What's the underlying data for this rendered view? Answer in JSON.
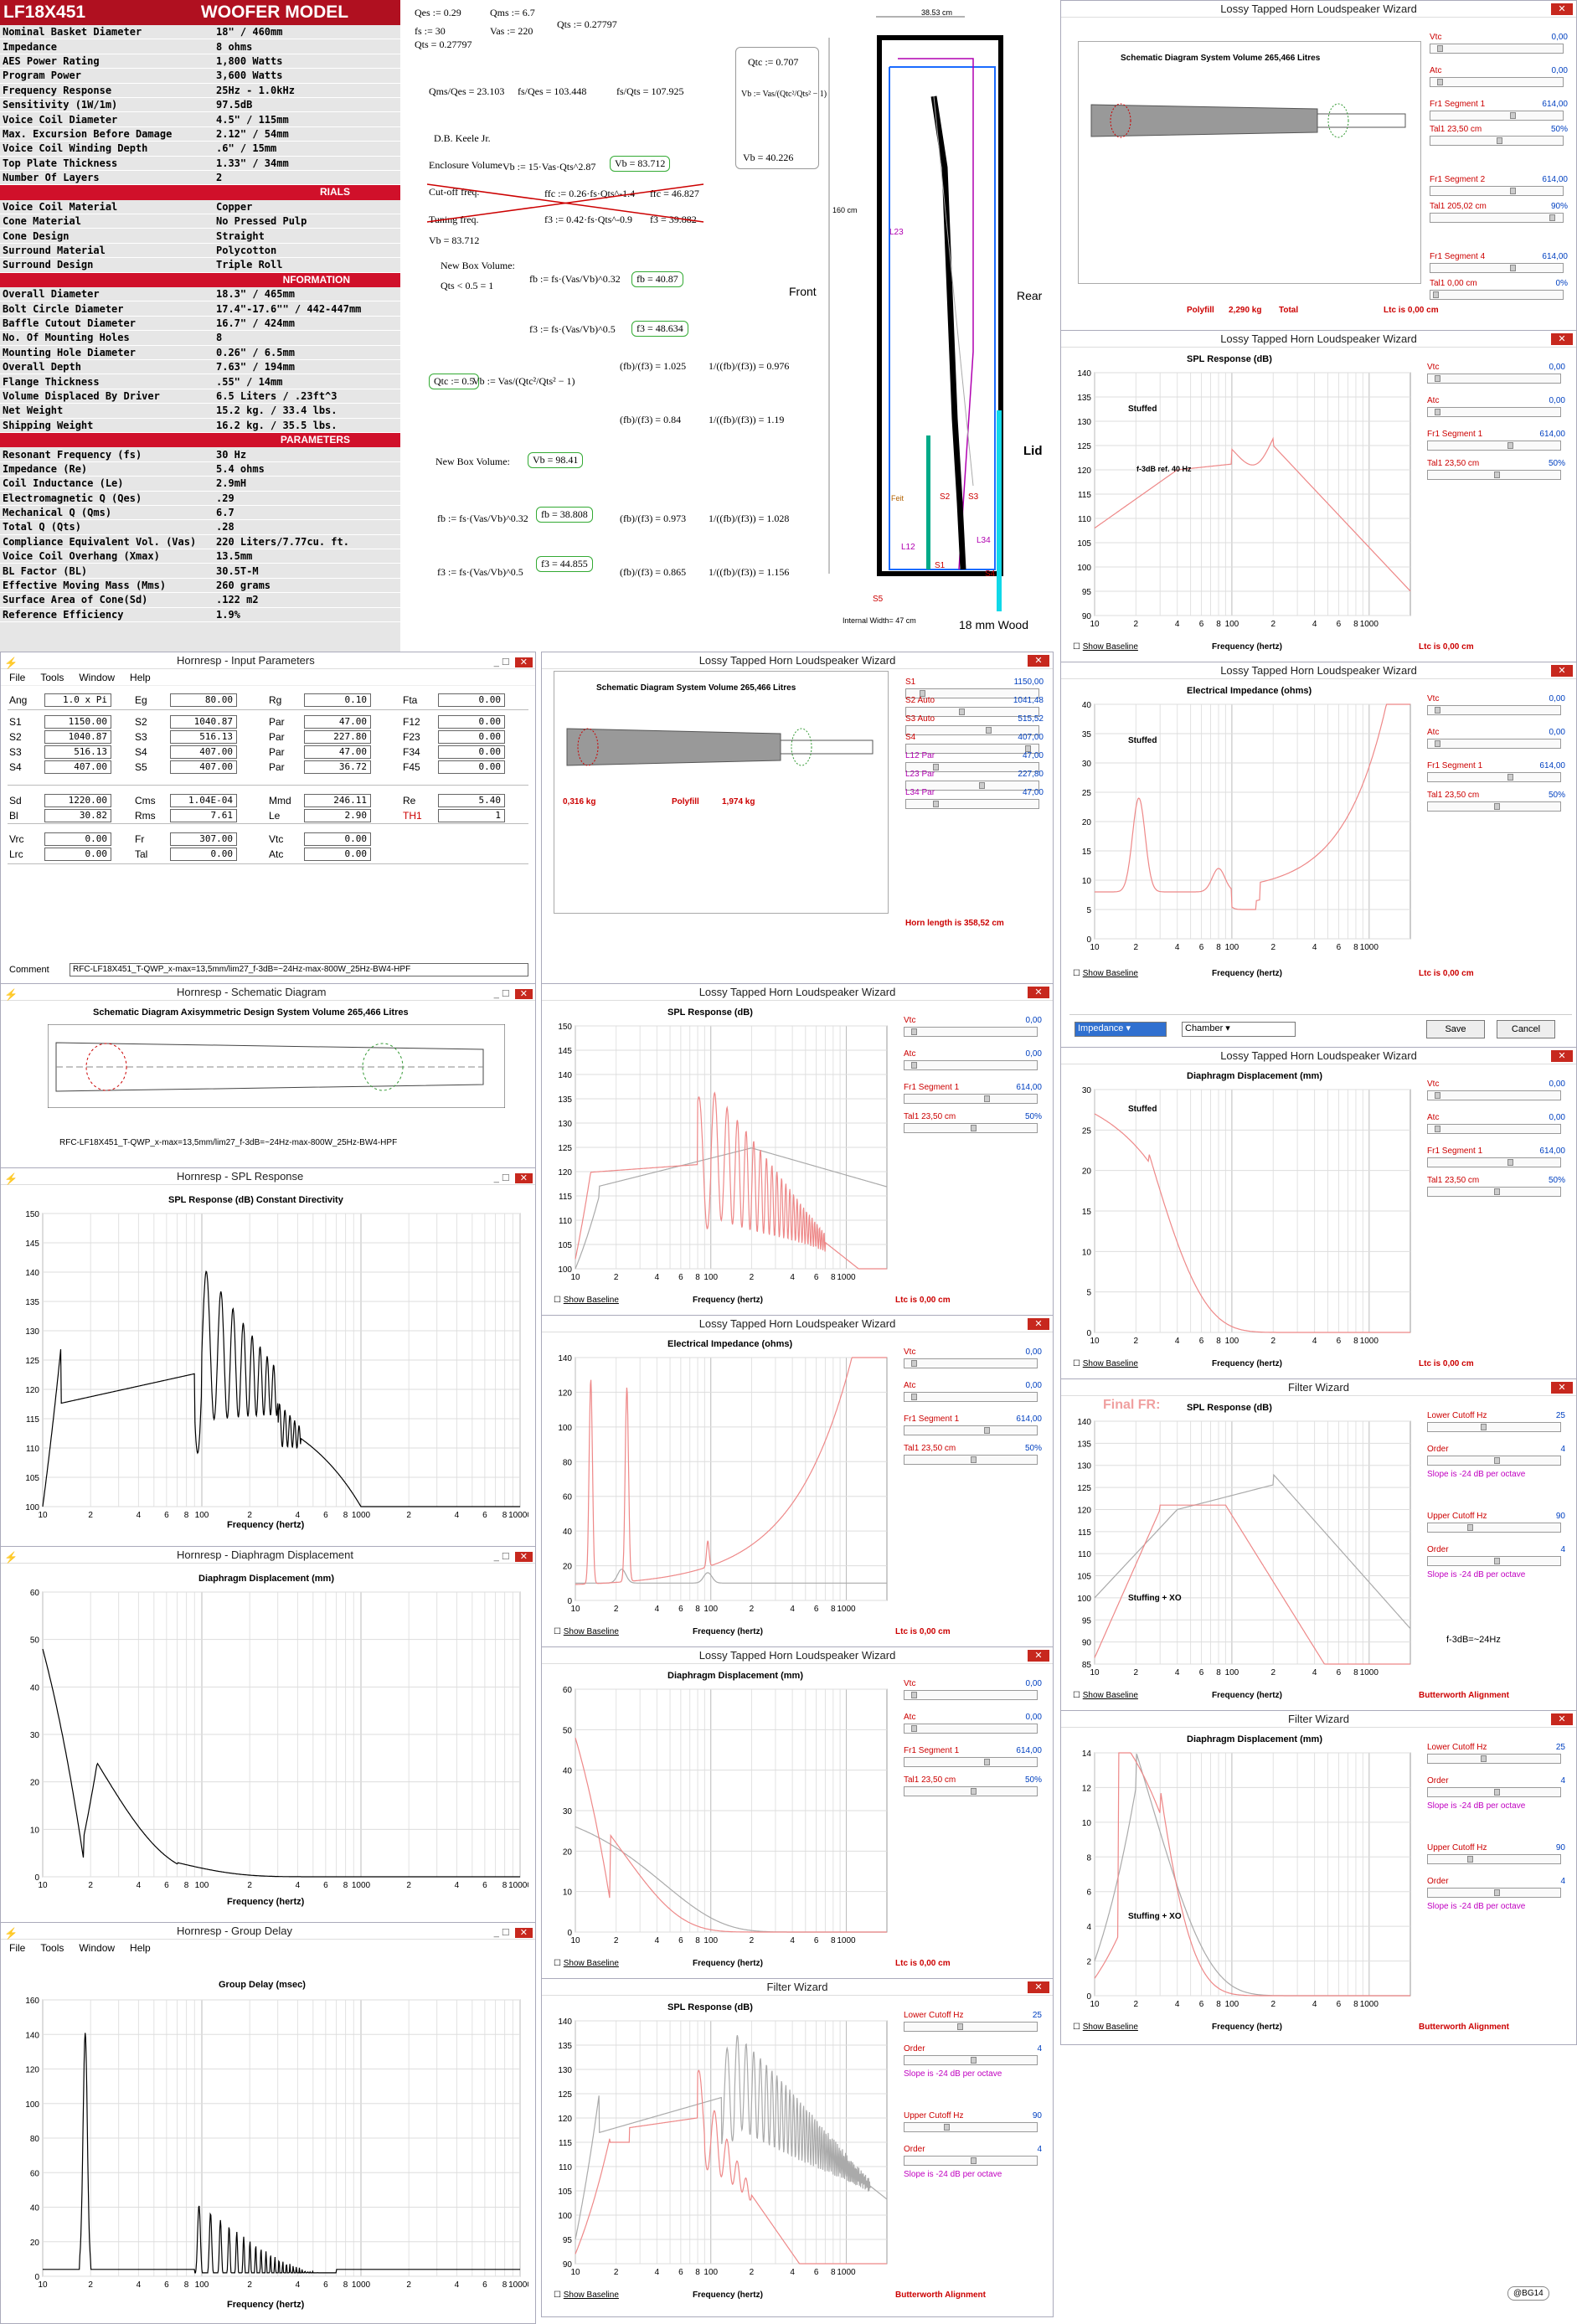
{
  "specs": {
    "model": "LF18X451",
    "title": "WOOFER MODEL",
    "rows": [
      [
        "Nominal Basket Diameter",
        "18\" / 460mm"
      ],
      [
        "Impedance",
        "8 ohms"
      ],
      [
        "AES Power Rating",
        "1,800 Watts"
      ],
      [
        "Program Power",
        "3,600 Watts"
      ],
      [
        "Frequency Response",
        "25Hz - 1.0kHz"
      ],
      [
        "Sensitivity (1W/1m)",
        "97.5dB"
      ],
      [
        "Voice Coil Diameter",
        "4.5\" / 115mm"
      ],
      [
        "Max. Excursion Before Damage",
        "2.12\" / 54mm"
      ],
      [
        "Voice Coil Winding Depth",
        ".6\" / 15mm"
      ],
      [
        "Top Plate Thickness",
        "1.33\" / 34mm"
      ],
      [
        "Number Of Layers",
        "2"
      ]
    ],
    "sec1": "RIALS",
    "rows2": [
      [
        "Voice Coil Material",
        "Copper"
      ],
      [
        "Cone Material",
        "No Pressed Pulp"
      ],
      [
        "Cone Design",
        "Straight"
      ],
      [
        "Surround Material",
        "Polycotton"
      ],
      [
        "Surround Design",
        "Triple Roll"
      ]
    ],
    "sec2": "NFORMATION",
    "rows3": [
      [
        "Overall Diameter",
        "18.3\" / 465mm"
      ],
      [
        "Bolt Circle Diameter",
        "17.4\"-17.6\"\" / 442-447mm"
      ],
      [
        "Baffle Cutout Diameter",
        "16.7\" / 424mm"
      ],
      [
        "No. Of Mounting Holes",
        "8"
      ],
      [
        "Mounting Hole Diameter",
        "0.26\" / 6.5mm"
      ],
      [
        "Overall Depth",
        "7.63\" / 194mm"
      ],
      [
        "Flange Thickness",
        ".55\" / 14mm"
      ],
      [
        "Volume Displaced By Driver",
        "6.5 Liters / .23ft^3"
      ],
      [
        "Net Weight",
        "15.2 kg. / 33.4 lbs."
      ],
      [
        "Shipping Weight",
        "16.2 kg. / 35.5 lbs."
      ]
    ],
    "sec3": "PARAMETERS",
    "rows4": [
      [
        "Resonant Frequency (fs)",
        "30 Hz"
      ],
      [
        "Impedance (Re)",
        "5.4 ohms"
      ],
      [
        "Coil Inductance (Le)",
        "2.9mH"
      ],
      [
        "Electromagnetic Q (Qes)",
        ".29"
      ],
      [
        "Mechanical Q (Qms)",
        "6.7"
      ],
      [
        "Total Q (Qts)",
        ".28"
      ],
      [
        "Compliance Equivalent Vol. (Vas)",
        "220 Liters/7.77cu. ft."
      ],
      [
        "Voice Coil Overhang (Xmax)",
        "13.5mm"
      ],
      [
        "BL Factor (BL)",
        "30.5T-M"
      ],
      [
        "Effective Moving Mass (Mms)",
        "260 grams"
      ],
      [
        "Surface Area of Cone(Sd)",
        ".122 m2"
      ],
      [
        "Reference Efficiency",
        "1.9%"
      ]
    ]
  },
  "calc": {
    "l1": "Qes := 0.29",
    "l2": "Qms := 6.7",
    "l3": "fs := 30",
    "l4": "Vas := 220",
    "l5": "Qts := 0.27797",
    "l6": "Qts = 0.27797",
    "r1": "Qms/Qes = 23.103",
    "r2": "fs/Qes = 103.448",
    "r3": "fs/Qts = 107.925",
    "keele": "D.B. Keele Jr.",
    "encl": "Enclosure Volume",
    "vbf": "Vb := 15·Vas·Qts^2.87",
    "vb1": "Vb = 83.712",
    "cut": "Cut-off freq.",
    "ffc": "ffc := 0.26·fs·Qts^-1.4",
    "ffcv": "ffc = 46.827",
    "tun": "Tuning freq.",
    "f3": "f3 := 0.42·fs·Qts^-0.9",
    "f3v": "f3 = 39.882",
    "vbe": "Vb = 83.712",
    "nbv": "New Box Volume:",
    "qtsc": "Qts < 0.5 = 1",
    "fbf": "fb := fs·(Vas/Vb)^0.32",
    "fbv": "fb = 40.87",
    "f3f": "f3 := fs·(Vas/Vb)^0.5",
    "f3v2": "f3 = 48.634",
    "qtc": "Qtc := 0.5",
    "vbq": "Vb := Vas/(Qtc²/Qts² − 1)",
    "ra": "(fb)/(f3) = 1.025",
    "rb": "1/((fb)/(f3)) = 0.976",
    "rc": "(fb)/(f3) = 0.84",
    "rd": "1/((fb)/(f3)) = 1.19",
    "nbv2": "New Box Volume:",
    "vb2": "Vb = 98.41",
    "fbf2": "fb := fs·(Vas/Vb)^0.32",
    "fbv2": "fb = 38.808",
    "re": "(fb)/(f3) = 0.973",
    "rf": "1/((fb)/(f3)) = 1.028",
    "f3f2": "f3 := fs·(Vas/Vb)^0.5",
    "f3v3": "f3 = 44.855",
    "rg": "(fb)/(f3) = 0.865",
    "rh": "1/((fb)/(f3)) = 1.156",
    "qtcb": "Qtc := 0.707",
    "vbb": "Vb := Vas/(Qtc²/Qts² − 1)",
    "vbbv": "Vb = 40.226"
  },
  "drawing": {
    "w": "38.53 cm",
    "h": "160 cm",
    "front": "Front",
    "rear": "Rear",
    "lid": "Lid",
    "wood": "18 mm Wood",
    "iw": "Internal Width= 47 cm",
    "labels": [
      "L23",
      "L12",
      "S1",
      "S2",
      "S3",
      "S4",
      "S5",
      "L34",
      "Feit"
    ]
  },
  "hr_input": {
    "title": "Hornresp - Input Parameters",
    "menu": [
      "File",
      "Tools",
      "Window",
      "Help"
    ],
    "rows": [
      [
        "Ang",
        "1.0 x Pi",
        "Eg",
        "80.00",
        "Rg",
        "0.10",
        "Fta",
        "0.00"
      ],
      [
        "S1",
        "1150.00",
        "S2",
        "1040.87",
        "Par",
        "47.00",
        "F12",
        "0.00"
      ],
      [
        "S2",
        "1040.87",
        "S3",
        "516.13",
        "Par",
        "227.80",
        "F23",
        "0.00"
      ],
      [
        "S3",
        "516.13",
        "S4",
        "407.00",
        "Par",
        "47.00",
        "F34",
        "0.00"
      ],
      [
        "S4",
        "407.00",
        "S5",
        "407.00",
        "Par",
        "36.72",
        "F45",
        "0.00"
      ],
      [
        "Sd",
        "1220.00",
        "Cms",
        "1.04E-04",
        "Mmd",
        "246.11",
        "Re",
        "5.40"
      ],
      [
        "Bl",
        "30.82",
        "Rms",
        "7.61",
        "Le",
        "2.90",
        "TH1",
        "1"
      ],
      [
        "Vrc",
        "0.00",
        "Fr",
        "307.00",
        "Vtc",
        "0.00",
        "",
        ""
      ],
      [
        "Lrc",
        "0.00",
        "Tal",
        "0.00",
        "Atc",
        "0.00",
        "",
        ""
      ]
    ],
    "comment_label": "Comment",
    "comment": "RFC-LF18X451_T-QWP_x-max=13,5mm/lim27_f-3dB=~24Hz-max-800W_25Hz-BW4-HPF"
  },
  "hr_schem": {
    "title": "Hornresp - Schematic Diagram",
    "head": "Schematic Diagram   Axisymmetric Design   System Volume 265,466 Litres",
    "caption": "RFC-LF18X451_T-QWP_x-max=13,5mm/lim27_f-3dB=~24Hz-max-800W_25Hz-BW4-HPF"
  },
  "hr_spl": {
    "title": "Hornresp - SPL Response",
    "head": "SPL Response (dB)    Constant Directivity",
    "xlabel": "Frequency (hertz)"
  },
  "hr_disp": {
    "title": "Hornresp - Diaphragm Displacement",
    "head": "Diaphragm Displacement (mm)",
    "xlabel": "Frequency (hertz)"
  },
  "hr_gd": {
    "title": "Hornresp - Group Delay",
    "menu": [
      "File",
      "Tools",
      "Window",
      "Help"
    ],
    "head": "Group Delay (msec)",
    "xlabel": "Frequency (hertz)"
  },
  "wiz": {
    "t1": "Lossy Tapped Horn Loudspeaker Wizard",
    "schem1": "Schematic Diagram   System Volume 265,466 Litres",
    "polyfill1": "Polyfill",
    "pf1": "2,290 kg",
    "total": "Total",
    "ltc": "Ltc is 0,00 cm",
    "spl1": "SPL Response (dB)",
    "stuffed": "Stuffed",
    "ref": "f-3dB ref. 40 Hz",
    "freq": "Frequency (hertz)",
    "baseline": "Show Baseline",
    "imp": "Electrical Impedance (ohms)",
    "disp": "Diaphragm Displacement (mm)",
    "dd1": "Impedance",
    "dd2": "Chamber",
    "save": "Save",
    "cancel": "Cancel",
    "m_schem": "Schematic Diagram   System Volume 265,466 Litres",
    "m_kg": "0,316 kg",
    "m_pf": "Polyfill",
    "m_pfv": "1,974 kg",
    "hornlen": "Horn length is 358,52 cm",
    "filter": "Filter Wizard",
    "finalfr": "Final FR:",
    "stuffxo": "Stuffing + XO",
    "f3db": "f-3dB=~24Hz",
    "butter": "Butterworth Alignment",
    "lower": "Lower Cutoff  Hz",
    "upper": "Upper Cutoff  Hz",
    "order": "Order",
    "slope": "Slope is -24 dB per octave",
    "lc": "25",
    "uc": "90",
    "ord": "4"
  },
  "side": {
    "vtc": "Vtc",
    "atc": "Atc",
    "fr1s1": "Fr1  Segment 1",
    "fr1s2": "Fr1  Segment 2",
    "fr1s4": "Fr1  Segment 4",
    "tal1": "Tal1  23,50 cm",
    "tal1b": "Tal1  205,02 cm",
    "tal1c": "Tal1  0,00 cm",
    "v0": "0,00",
    "v614": "614,00",
    "p50": "50%",
    "p90": "90%",
    "p0": "0%"
  },
  "mside": [
    [
      "S1",
      "1150,00"
    ],
    [
      "S2  Auto",
      "1041,48"
    ],
    [
      "S3  Auto",
      "515,52"
    ],
    [
      "S4",
      "407,00"
    ],
    [
      "L12  Par",
      "47,00"
    ],
    [
      "L23  Par",
      "227,80"
    ],
    [
      "L34  Par",
      "47,00"
    ]
  ],
  "mside2": [
    [
      "S5",
      "407,00"
    ],
    [
      "L45  Par",
      "36,72"
    ]
  ],
  "signature": "@BG14"
}
